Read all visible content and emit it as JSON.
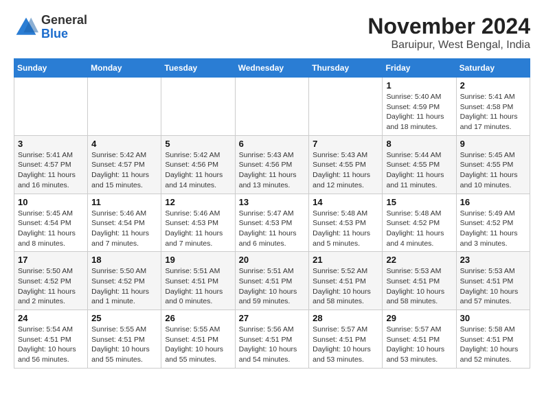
{
  "header": {
    "logo_general": "General",
    "logo_blue": "Blue",
    "month_title": "November 2024",
    "location": "Baruipur, West Bengal, India"
  },
  "weekdays": [
    "Sunday",
    "Monday",
    "Tuesday",
    "Wednesday",
    "Thursday",
    "Friday",
    "Saturday"
  ],
  "weeks": [
    [
      {
        "day": "",
        "info": ""
      },
      {
        "day": "",
        "info": ""
      },
      {
        "day": "",
        "info": ""
      },
      {
        "day": "",
        "info": ""
      },
      {
        "day": "",
        "info": ""
      },
      {
        "day": "1",
        "info": "Sunrise: 5:40 AM\nSunset: 4:59 PM\nDaylight: 11 hours and 18 minutes."
      },
      {
        "day": "2",
        "info": "Sunrise: 5:41 AM\nSunset: 4:58 PM\nDaylight: 11 hours and 17 minutes."
      }
    ],
    [
      {
        "day": "3",
        "info": "Sunrise: 5:41 AM\nSunset: 4:57 PM\nDaylight: 11 hours and 16 minutes."
      },
      {
        "day": "4",
        "info": "Sunrise: 5:42 AM\nSunset: 4:57 PM\nDaylight: 11 hours and 15 minutes."
      },
      {
        "day": "5",
        "info": "Sunrise: 5:42 AM\nSunset: 4:56 PM\nDaylight: 11 hours and 14 minutes."
      },
      {
        "day": "6",
        "info": "Sunrise: 5:43 AM\nSunset: 4:56 PM\nDaylight: 11 hours and 13 minutes."
      },
      {
        "day": "7",
        "info": "Sunrise: 5:43 AM\nSunset: 4:55 PM\nDaylight: 11 hours and 12 minutes."
      },
      {
        "day": "8",
        "info": "Sunrise: 5:44 AM\nSunset: 4:55 PM\nDaylight: 11 hours and 11 minutes."
      },
      {
        "day": "9",
        "info": "Sunrise: 5:45 AM\nSunset: 4:55 PM\nDaylight: 11 hours and 10 minutes."
      }
    ],
    [
      {
        "day": "10",
        "info": "Sunrise: 5:45 AM\nSunset: 4:54 PM\nDaylight: 11 hours and 8 minutes."
      },
      {
        "day": "11",
        "info": "Sunrise: 5:46 AM\nSunset: 4:54 PM\nDaylight: 11 hours and 7 minutes."
      },
      {
        "day": "12",
        "info": "Sunrise: 5:46 AM\nSunset: 4:53 PM\nDaylight: 11 hours and 7 minutes."
      },
      {
        "day": "13",
        "info": "Sunrise: 5:47 AM\nSunset: 4:53 PM\nDaylight: 11 hours and 6 minutes."
      },
      {
        "day": "14",
        "info": "Sunrise: 5:48 AM\nSunset: 4:53 PM\nDaylight: 11 hours and 5 minutes."
      },
      {
        "day": "15",
        "info": "Sunrise: 5:48 AM\nSunset: 4:52 PM\nDaylight: 11 hours and 4 minutes."
      },
      {
        "day": "16",
        "info": "Sunrise: 5:49 AM\nSunset: 4:52 PM\nDaylight: 11 hours and 3 minutes."
      }
    ],
    [
      {
        "day": "17",
        "info": "Sunrise: 5:50 AM\nSunset: 4:52 PM\nDaylight: 11 hours and 2 minutes."
      },
      {
        "day": "18",
        "info": "Sunrise: 5:50 AM\nSunset: 4:52 PM\nDaylight: 11 hours and 1 minute."
      },
      {
        "day": "19",
        "info": "Sunrise: 5:51 AM\nSunset: 4:51 PM\nDaylight: 11 hours and 0 minutes."
      },
      {
        "day": "20",
        "info": "Sunrise: 5:51 AM\nSunset: 4:51 PM\nDaylight: 10 hours and 59 minutes."
      },
      {
        "day": "21",
        "info": "Sunrise: 5:52 AM\nSunset: 4:51 PM\nDaylight: 10 hours and 58 minutes."
      },
      {
        "day": "22",
        "info": "Sunrise: 5:53 AM\nSunset: 4:51 PM\nDaylight: 10 hours and 58 minutes."
      },
      {
        "day": "23",
        "info": "Sunrise: 5:53 AM\nSunset: 4:51 PM\nDaylight: 10 hours and 57 minutes."
      }
    ],
    [
      {
        "day": "24",
        "info": "Sunrise: 5:54 AM\nSunset: 4:51 PM\nDaylight: 10 hours and 56 minutes."
      },
      {
        "day": "25",
        "info": "Sunrise: 5:55 AM\nSunset: 4:51 PM\nDaylight: 10 hours and 55 minutes."
      },
      {
        "day": "26",
        "info": "Sunrise: 5:55 AM\nSunset: 4:51 PM\nDaylight: 10 hours and 55 minutes."
      },
      {
        "day": "27",
        "info": "Sunrise: 5:56 AM\nSunset: 4:51 PM\nDaylight: 10 hours and 54 minutes."
      },
      {
        "day": "28",
        "info": "Sunrise: 5:57 AM\nSunset: 4:51 PM\nDaylight: 10 hours and 53 minutes."
      },
      {
        "day": "29",
        "info": "Sunrise: 5:57 AM\nSunset: 4:51 PM\nDaylight: 10 hours and 53 minutes."
      },
      {
        "day": "30",
        "info": "Sunrise: 5:58 AM\nSunset: 4:51 PM\nDaylight: 10 hours and 52 minutes."
      }
    ]
  ]
}
